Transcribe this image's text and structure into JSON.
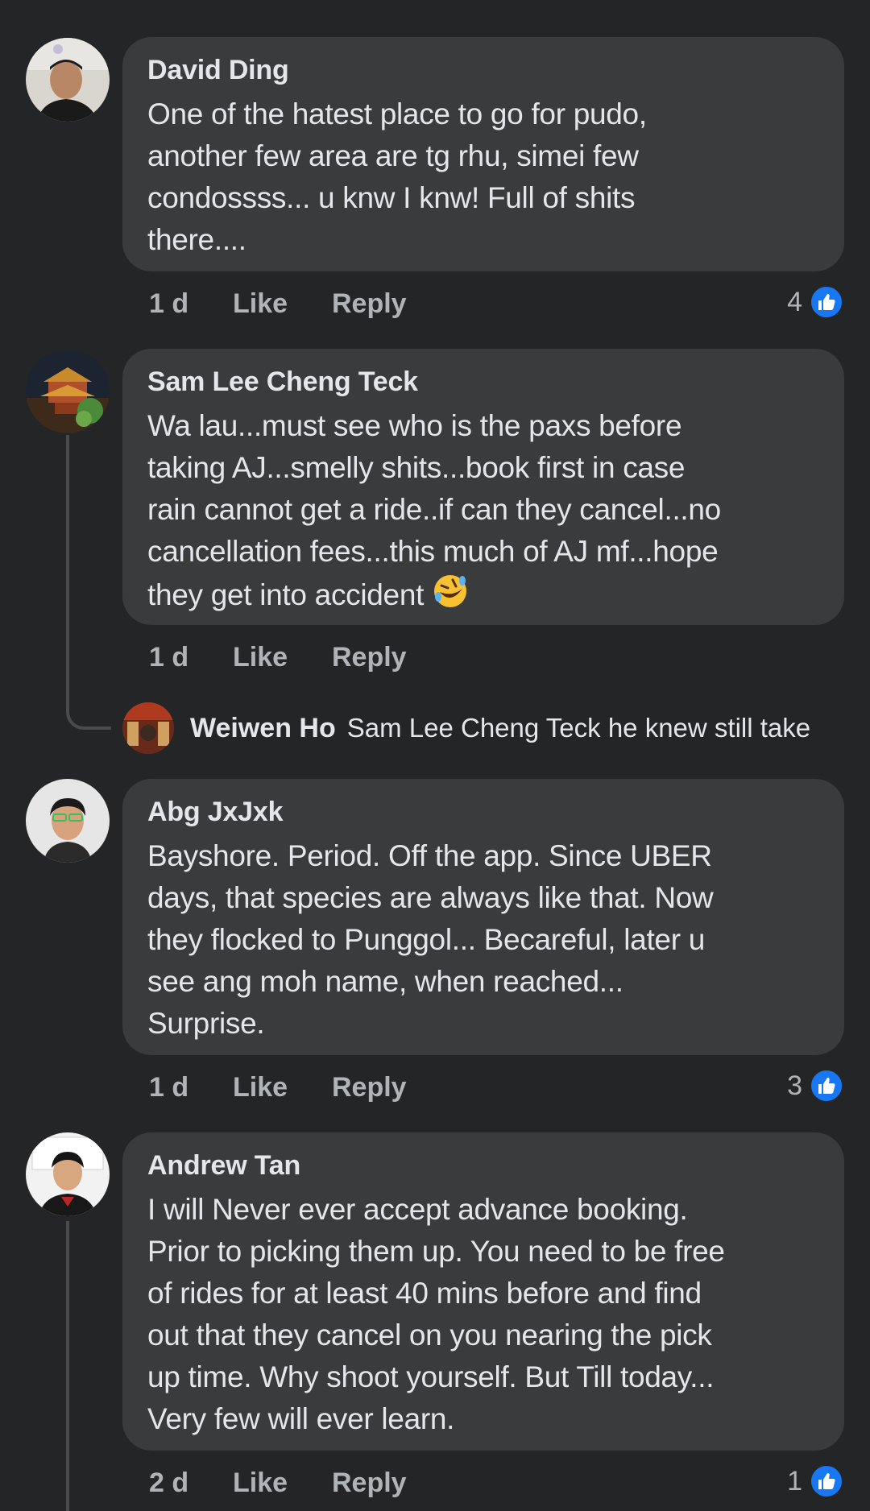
{
  "comments": [
    {
      "author": "David Ding",
      "lines": [
        "One of the hatest place to go for pudo,",
        "another few area are tg rhu, simei few",
        "condossss... u knw I knw! Full of shits",
        "there...."
      ],
      "time": "1 d",
      "like_label": "Like",
      "reply_label": "Reply",
      "reaction_count": "4"
    },
    {
      "author": "Sam Lee Cheng Teck",
      "lines": [
        "Wa lau...must see who is the paxs before",
        "taking AJ...smelly shits...book first in case",
        "rain cannot get a ride..if can they cancel...no",
        "cancellation fees...this much of AJ mf...hope",
        "they get into accident"
      ],
      "emoji": "rolling-on-floor-laughing-emoji",
      "time": "1 d",
      "like_label": "Like",
      "reply_label": "Reply"
    },
    {
      "author": "Abg JxJxk",
      "lines": [
        "Bayshore. Period. Off the app. Since UBER",
        "days, that species are always like that. Now",
        "they flocked to Punggol... Becareful, later u",
        "see ang moh name, when reached...",
        "Surprise."
      ],
      "time": "1 d",
      "like_label": "Like",
      "reply_label": "Reply",
      "reaction_count": "3"
    },
    {
      "author": "Andrew Tan",
      "lines": [
        "I will Never ever accept advance booking.",
        "Prior to picking them up. You need to be free",
        "of rides for at least 40 mins before and find",
        "out that they cancel on you nearing the pick",
        "up time. Why shoot yourself. But Till today...",
        "Very few will ever learn."
      ],
      "time": "2 d",
      "like_label": "Like",
      "reply_label": "Reply",
      "reaction_count": "1"
    }
  ],
  "reply_preview": {
    "author": "Weiwen Ho",
    "text": "Sam Lee Cheng Teck he knew still take"
  },
  "colors": {
    "background": "#242526",
    "bubble": "#3a3b3c",
    "text": "#e4e6eb",
    "secondary": "#b0b3b8",
    "like_blue": "#1877f2"
  }
}
